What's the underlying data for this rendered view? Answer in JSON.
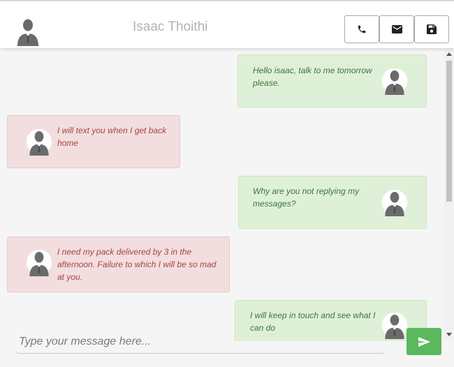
{
  "header": {
    "name": "Isaac Thoithi",
    "avatar_icon": "person-silhouette-icon",
    "buttons": [
      {
        "name": "call-button",
        "icon": "phone-icon"
      },
      {
        "name": "email-button",
        "icon": "envelope-icon"
      },
      {
        "name": "save-button",
        "icon": "floppy-disk-icon"
      }
    ]
  },
  "messages": [
    {
      "direction": "outgoing",
      "text": "Hello isaac, talk to me tomorrow please."
    },
    {
      "direction": "incoming",
      "text": "I will text you when I get back home"
    },
    {
      "direction": "outgoing",
      "text": "Why are you not replying my messages?"
    },
    {
      "direction": "incoming",
      "text": "I need my pack delivered by 3 in the afternoon. Failure to which I will be so mad at you."
    },
    {
      "direction": "outgoing",
      "text": "I will keep in touch and see what I can do"
    }
  ],
  "composer": {
    "placeholder": "Type your message here...",
    "value": ""
  },
  "send_button": {
    "icon": "paper-plane-icon"
  },
  "colors": {
    "outgoing_bg": "#dff0d8",
    "outgoing_text": "#3c763d",
    "incoming_bg": "#f2dede",
    "incoming_text": "#a94442",
    "send_bg": "#5cb85c"
  }
}
